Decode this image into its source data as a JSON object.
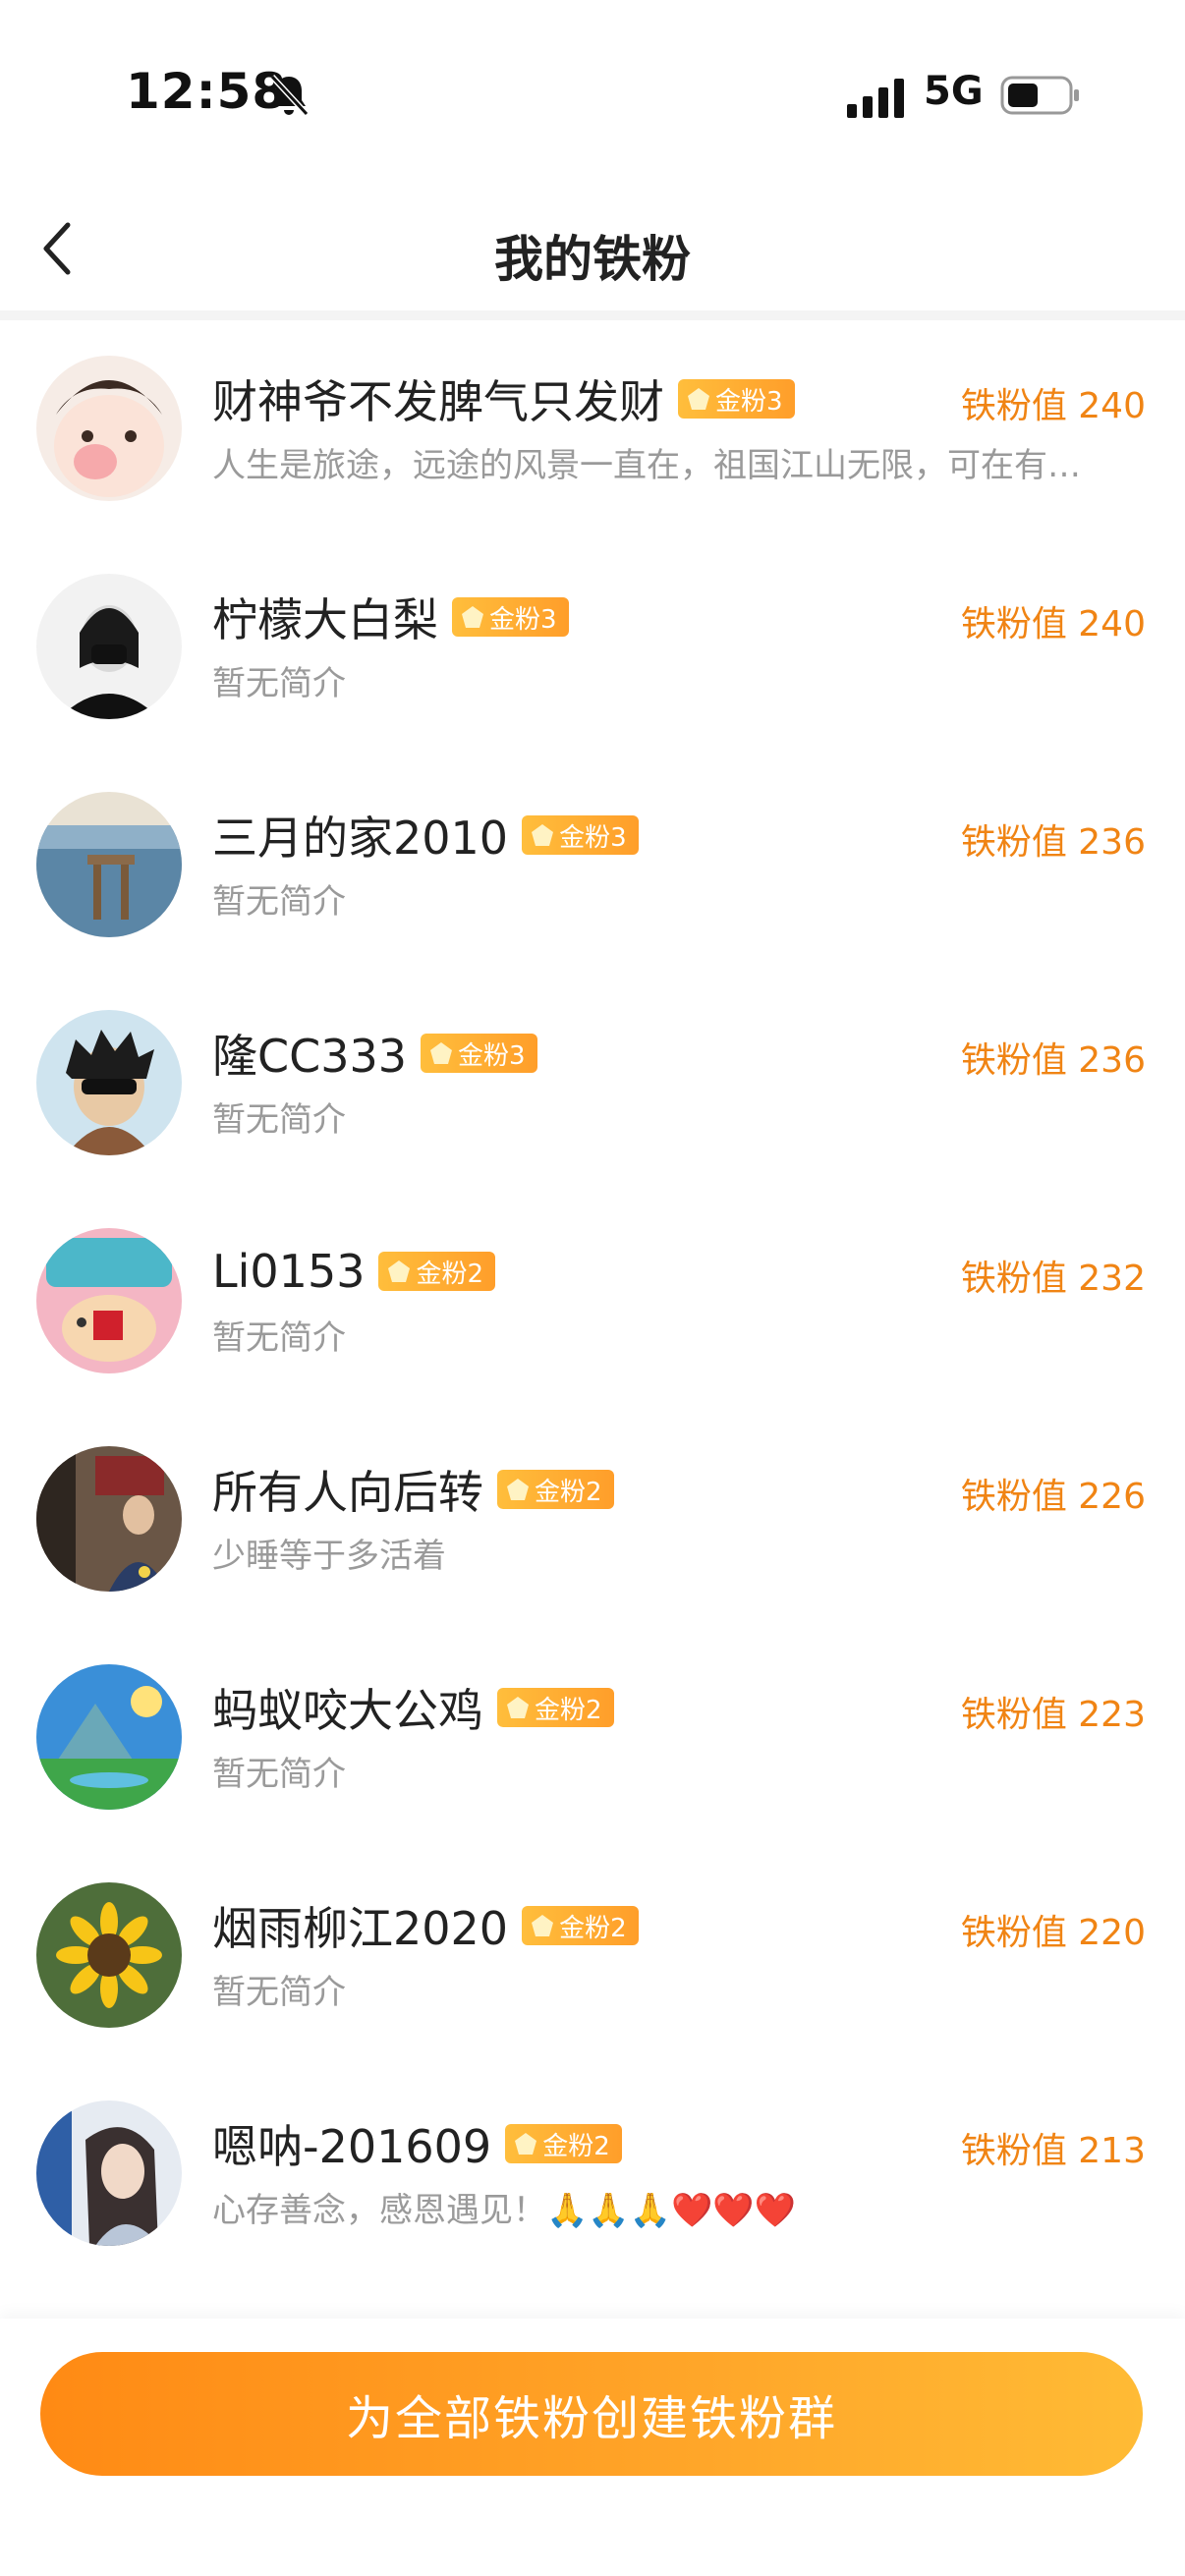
{
  "status_bar": {
    "time": "12:58",
    "network": "5G"
  },
  "header": {
    "title": "我的铁粉"
  },
  "fans": [
    {
      "name": "财神爷不发脾气只发财",
      "badge": "金粉3",
      "value": "铁粉值 240",
      "bio": "人生是旅途，远途的风景一直在，祖国江山无限，可在有…"
    },
    {
      "name": "柠檬大白梨",
      "badge": "金粉3",
      "value": "铁粉值 240",
      "bio": "暂无简介"
    },
    {
      "name": "三月的家2010",
      "badge": "金粉3",
      "value": "铁粉值 236",
      "bio": "暂无简介"
    },
    {
      "name": "隆CC333",
      "badge": "金粉3",
      "value": "铁粉值 236",
      "bio": "暂无简介"
    },
    {
      "name": "Li0153",
      "badge": "金粉2",
      "value": "铁粉值 232",
      "bio": "暂无简介"
    },
    {
      "name": "所有人向后转",
      "badge": "金粉2",
      "value": "铁粉值 226",
      "bio": "少睡等于多活着"
    },
    {
      "name": "蚂蚁咬大公鸡",
      "badge": "金粉2",
      "value": "铁粉值 223",
      "bio": "暂无简介"
    },
    {
      "name": "烟雨柳江2020",
      "badge": "金粉2",
      "value": "铁粉值 220",
      "bio": "暂无简介"
    },
    {
      "name": "嗯呐-201609",
      "badge": "金粉2",
      "value": "铁粉值 213",
      "bio": "心存善念，感恩遇见！🙏🙏🙏❤️❤️❤️"
    }
  ],
  "bottom": {
    "button_label": "为全部铁粉创建铁粉群"
  },
  "colors": {
    "accent": "#f08414",
    "badge": "#ffaa30",
    "bio": "#9a9a9a"
  }
}
